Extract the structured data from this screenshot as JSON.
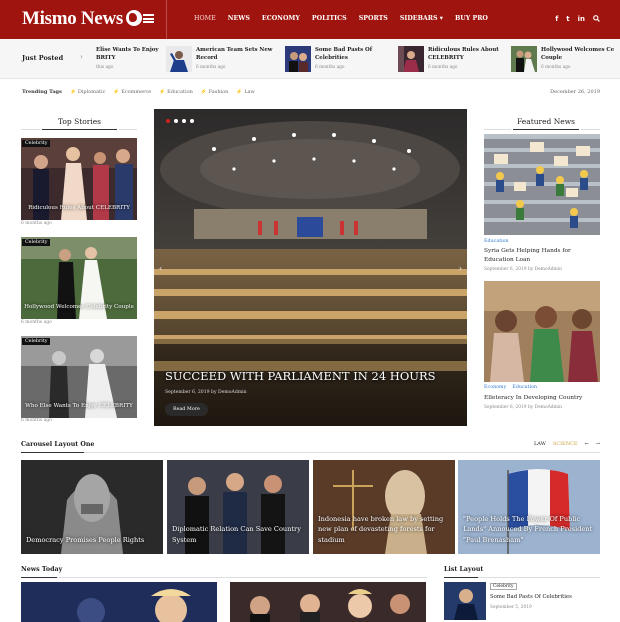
{
  "brand": {
    "name": "Mismo News",
    "accent": "#a0140f"
  },
  "nav": {
    "items": [
      "HOME",
      "NEWS",
      "ECONOMY",
      "POLITICS",
      "SPORTS",
      "SIDEBARS",
      "BUY PRO"
    ],
    "social": [
      "f",
      "t",
      "in",
      "search"
    ]
  },
  "just_posted": {
    "label": "Just Posted",
    "items": [
      {
        "title": "Elise Wants To Enjoy BRITY",
        "date": "this ago"
      },
      {
        "title": "American Team Sets New Record",
        "date": "6 months ago"
      },
      {
        "title": "Some Bad Pasts Of Celebrities",
        "date": "6 months ago"
      },
      {
        "title": "Ridiculous Rules About CELEBRITY",
        "date": "6 months ago"
      },
      {
        "title": "Hollywood Welcomes Ce Couple",
        "date": "6 months ago"
      }
    ]
  },
  "trending": {
    "label": "Trending Tags",
    "tags": [
      "Diplomatic",
      "Ecommerce",
      "Education",
      "Fashion",
      "Law"
    ],
    "date": "December 26, 2019"
  },
  "top_stories": {
    "title": "Top Stories",
    "items": [
      {
        "badge": "Celebrity",
        "title": "Ridiculous Rules About CELEBRITY",
        "date": "6 months ago"
      },
      {
        "badge": "Celebrity",
        "title": "Hollywood Welcomes Celebrity Couple",
        "date": "6 months ago"
      },
      {
        "badge": "Celebrity",
        "title": "Who Else Wants To Enjoy CELEBRITY",
        "date": "6 months ago"
      }
    ]
  },
  "slider": {
    "title": "SUCCEED WITH PARLIAMENT IN 24 HOURS",
    "meta": "September 6, 2019 by DemoAdmin",
    "button": "Read More",
    "prev": "‹",
    "next": "›"
  },
  "featured": {
    "title": "Featured News",
    "items": [
      {
        "cats": [
          "Education"
        ],
        "title": "Syria Gets Helping Hands for Education Loan",
        "meta": "September 6, 2019 by DemoAdmin"
      },
      {
        "cats": [
          "Economy",
          "Education"
        ],
        "title": "Elleteracy In Developing Country",
        "meta": "September 6, 2019 by DemoAdmin"
      }
    ]
  },
  "carousel": {
    "title": "Carousel Layout One",
    "tabs": [
      "LAW",
      "SCIENCE",
      "←",
      "→"
    ],
    "items": [
      {
        "title": "Democracy Promises People Rights"
      },
      {
        "title": "Diplomatic Relation Can Save Country System"
      },
      {
        "title": "Indonesia have broken law by setting new plan of devasteting forests for stadium"
      },
      {
        "title": "\"People Holds The Power Of Public Lands\" Annouced By French President \"Paul Brenasham\""
      }
    ]
  },
  "news_today": {
    "title": "News Today"
  },
  "list_layout": {
    "title": "List Layout",
    "item": {
      "badge": "Celebrity",
      "title": "Some Bad Pasts Of Celebrities",
      "date": "September 5, 2019"
    }
  }
}
